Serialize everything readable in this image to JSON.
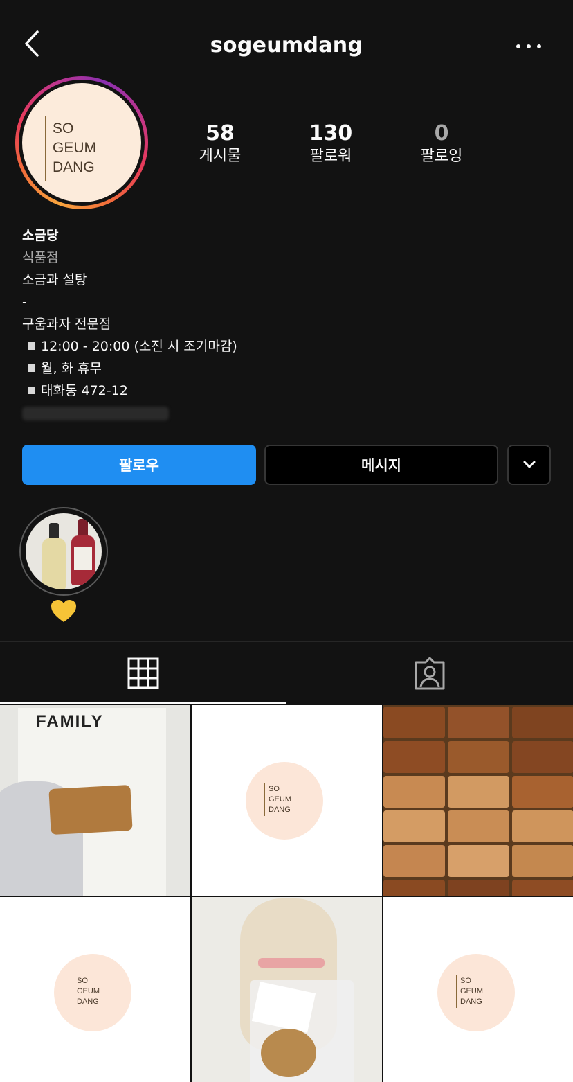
{
  "header": {
    "username": "sogeumdang",
    "back_icon": "chevron-left-icon",
    "more_icon": "ellipsis-icon"
  },
  "profile": {
    "avatar_logo_lines": [
      "SO",
      "GEUM",
      "DANG"
    ],
    "stats": [
      {
        "value": "58",
        "label": "게시물"
      },
      {
        "value": "130",
        "label": "팔로워"
      },
      {
        "value": "0",
        "label": "팔로잉"
      }
    ]
  },
  "bio": {
    "name": "소금당",
    "category": "식품점",
    "line1": "소금과 설탕",
    "line2": "-",
    "line3": "구움과자 전문점",
    "bullets": [
      "12:00 - 20:00 (소진 시 조기마감)",
      "월, 화 휴무",
      "태화동 472-12"
    ]
  },
  "actions": {
    "follow_label": "팔로우",
    "message_label": "메시지",
    "dropdown_icon": "chevron-down-icon"
  },
  "highlights": [
    {
      "label": "💛"
    }
  ],
  "tabs": [
    {
      "name": "posts",
      "icon": "grid-icon",
      "active": true
    },
    {
      "name": "tagged",
      "icon": "tagged-person-icon",
      "active": false
    }
  ],
  "posts": {
    "logo_lines": [
      "SO",
      "GEUM",
      "DANG"
    ],
    "family_text": "FAMILY"
  },
  "colors": {
    "background": "#121212",
    "follow_button": "#1f8ef2",
    "avatar_bg": "#fcebdb"
  }
}
